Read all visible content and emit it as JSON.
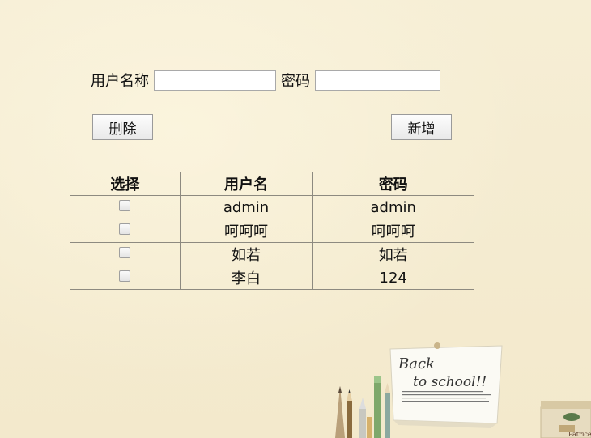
{
  "search": {
    "username_label": "用户名称",
    "username_value": "",
    "password_label": "密码",
    "password_value": ""
  },
  "buttons": {
    "delete_label": "删除",
    "add_label": "新增"
  },
  "table": {
    "headers": [
      "选择",
      "用户名",
      "密码"
    ],
    "rows": [
      {
        "checked": false,
        "username": "admin",
        "password": "admin"
      },
      {
        "checked": false,
        "username": "呵呵呵",
        "password": "呵呵呵"
      },
      {
        "checked": false,
        "username": "如若",
        "password": "如若"
      },
      {
        "checked": false,
        "username": "李白",
        "password": "124"
      }
    ]
  },
  "decoration": {
    "note_line1": "Back",
    "note_line2": "to school!!",
    "box_label": "Patrice"
  },
  "colors": {
    "background": "#f5ecd0",
    "table_border": "#8d8a80"
  }
}
